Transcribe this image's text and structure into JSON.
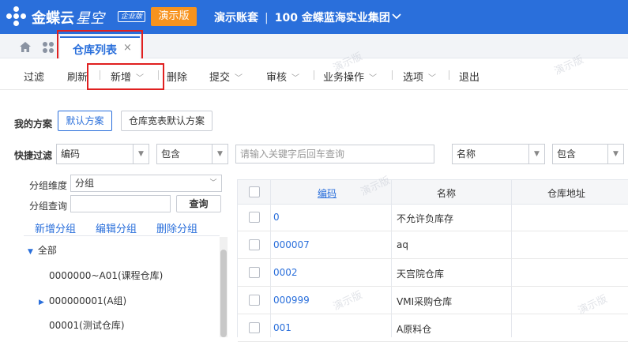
{
  "header": {
    "brand": "金蝶云",
    "brand_sub": "星空",
    "edition": "企业版",
    "demo_label": "演示版",
    "account": "演示账套",
    "org": "100 金蝶蓝海实业集团"
  },
  "tabs": [
    {
      "label": "仓库列表",
      "close": "×"
    }
  ],
  "toolbar": {
    "items": [
      "过滤",
      "刷新",
      "新增",
      "删除",
      "提交",
      "审核",
      "业务操作",
      "选项",
      "退出"
    ]
  },
  "scheme": {
    "label": "我的方案",
    "buttons": [
      "默认方案",
      "仓库宽表默认方案"
    ]
  },
  "quick_filter": {
    "label": "快捷过滤",
    "field1": "编码",
    "op1": "包含",
    "placeholder": "请输入关键字后回车查询",
    "field2": "名称",
    "op2": "包含"
  },
  "group_panel": {
    "dimension_label": "分组维度",
    "dimension_value": "分组",
    "query_label": "分组查询",
    "query_button": "查询",
    "links": [
      "新增分组",
      "编辑分组",
      "删除分组"
    ],
    "tree": [
      "全部",
      "0000000~A01(课程仓库)",
      "000000001(A组)",
      "00001(测试仓库)"
    ]
  },
  "table": {
    "columns": [
      "编码",
      "名称",
      "仓库地址"
    ],
    "rows": [
      {
        "code": "0",
        "name": "不允许负库存"
      },
      {
        "code": "000007",
        "name": "aq"
      },
      {
        "code": "0002",
        "name": "天宫院仓库"
      },
      {
        "code": "000999",
        "name": "VMI采购仓库"
      },
      {
        "code": "001",
        "name": "A原料仓"
      }
    ]
  },
  "colors": {
    "primary": "#2a6fdb",
    "orange": "#f7931e",
    "highlight": "#e02020"
  }
}
